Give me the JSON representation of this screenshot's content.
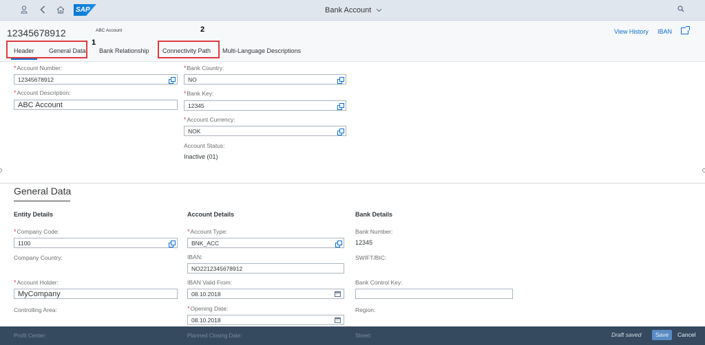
{
  "shell": {
    "logo": "SAP",
    "title": "Bank Account",
    "icons": [
      "user-icon",
      "back-icon",
      "home-icon",
      "chevron-down-icon",
      "search-icon"
    ]
  },
  "header": {
    "object_title": "12345678912",
    "object_subtitle": "ABC Account",
    "actions": {
      "view_history": "View History",
      "iban": "IBAN"
    },
    "callouts": [
      "1",
      "2"
    ],
    "tabs": [
      "Header",
      "General Data",
      "Bank Relationship",
      "Connectivity Path",
      "Multi-Language Descriptions"
    ],
    "selected_tab": "Header"
  },
  "header_section": {
    "account_number": {
      "label": "Account Number:",
      "value": "12345678912",
      "required": true
    },
    "account_description": {
      "label": "Account Description:",
      "value": "ABC Account",
      "required": true
    },
    "bank_country": {
      "label": "Bank Country:",
      "value": "NO",
      "required": true
    },
    "bank_key": {
      "label": "Bank Key:",
      "value": "12345",
      "required": true
    },
    "account_currency": {
      "label": "Account Currency:",
      "value": "NOK",
      "required": true
    },
    "account_status": {
      "label": "Account Status:",
      "value": "Inactive (01)"
    }
  },
  "general_data": {
    "title": "General Data",
    "entity_details": {
      "heading": "Entity Details",
      "company_code": {
        "label": "Company Code:",
        "value": "1100",
        "required": true
      },
      "company_country": {
        "label": "Company Country:"
      },
      "account_holder": {
        "label": "Account Holder:",
        "value": "MyCompany",
        "required": true
      },
      "controlling_area": {
        "label": "Controlling Area:"
      },
      "ghost_label": "Profit Center:"
    },
    "account_details": {
      "heading": "Account Details",
      "account_type": {
        "label": "Account Type:",
        "value": "BNK_ACC",
        "required": true
      },
      "iban": {
        "label": "IBAN:",
        "value": "NO2212345678912"
      },
      "iban_valid_from": {
        "label": "IBAN Valid From:",
        "value": "08.10.2018"
      },
      "opening_date": {
        "label": "Opening Date:",
        "value": "08.10.2018",
        "required": true
      },
      "ghost_label": "Planned Closing Date:"
    },
    "bank_details": {
      "heading": "Bank Details",
      "bank_number": {
        "label": "Bank Number:",
        "value": "12345"
      },
      "swift_bic": {
        "label": "SWIFT/BIC:"
      },
      "bank_control_key": {
        "label": "Bank Control Key:",
        "value": ""
      },
      "region": {
        "label": "Region:"
      },
      "ghost_label": "Street:"
    }
  },
  "footer": {
    "status": "Draft saved",
    "save_label": "Save",
    "cancel_label": "Cancel"
  },
  "colors": {
    "shell_bg": "#dfe6ee",
    "accent": "#0a6ed1",
    "required": "#e0393e",
    "callout_box": "#e0393e",
    "footer_bg": "#354a5f"
  }
}
